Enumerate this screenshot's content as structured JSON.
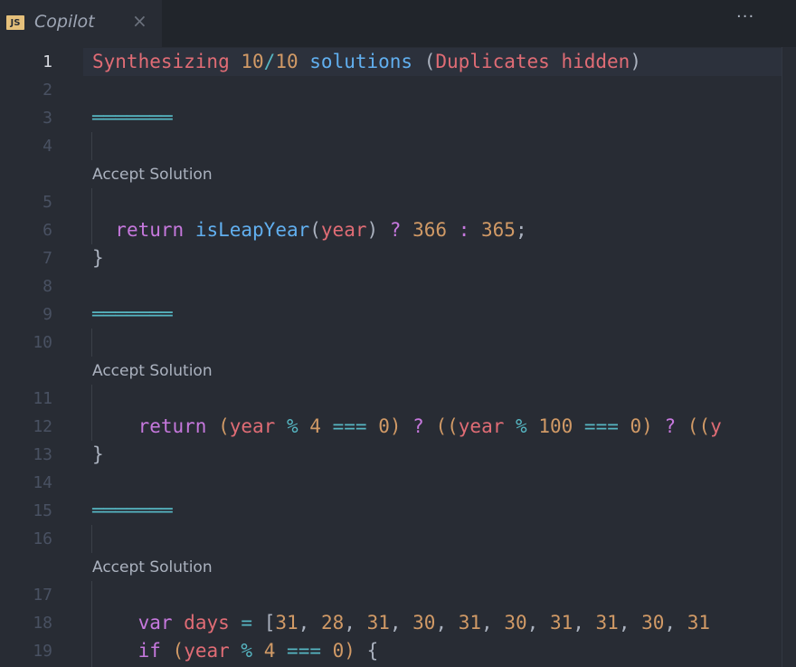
{
  "tab": {
    "badge": "JS",
    "title": "Copilot",
    "close_glyph": "×",
    "more_glyph": "···"
  },
  "gutter": {
    "line_numbers": [
      "1",
      "2",
      "3",
      "4",
      "5",
      "6",
      "7",
      "8",
      "9",
      "10",
      "11",
      "12",
      "13",
      "14",
      "15",
      "16",
      "17",
      "18",
      "19"
    ],
    "active_line": "1"
  },
  "header_line": {
    "word1": "Synthesizing",
    "count": "10",
    "slash": "/",
    "total": "10",
    "word2": "solutions",
    "paren_open": "(",
    "note": "Duplicates hidden",
    "paren_close": ")"
  },
  "separator": "═══════",
  "codelens_label": "Accept Solution",
  "solution1": {
    "kw_return": "return",
    "fn": "isLeapYear",
    "lp": "(",
    "arg": "year",
    "rp": ")",
    "q": "?",
    "n1": "366",
    "colon": ":",
    "n2": "365",
    "semi": ";",
    "close": "}"
  },
  "solution2": {
    "kw_return": "return",
    "lp": "(",
    "v1": "year",
    "mod": "%",
    "n4": "4",
    "eq1": "===",
    "z1": "0",
    "rp": ")",
    "q1": "?",
    "lp2": "((",
    "v2": "year",
    "mod2": "%",
    "n100": "100",
    "eq2": "===",
    "z2": "0",
    "rp2": ")",
    "q2": "?",
    "lp3": "((",
    "cut": "y",
    "close": "}"
  },
  "solution3": {
    "kw_var": "var",
    "var_name": "days",
    "assign": "=",
    "lb": "[",
    "days": [
      "31",
      "28",
      "31",
      "30",
      "31",
      "30",
      "31",
      "31",
      "30",
      "31"
    ],
    "kw_if": "if",
    "lp": "(",
    "v": "year",
    "mod": "%",
    "n4": "4",
    "eq": "===",
    "z": "0",
    "rp": ")",
    "brace": "{"
  },
  "colors": {
    "background": "#282c34",
    "tabbar": "#21252b",
    "red": "#e06c75",
    "orange": "#d19a66",
    "blue": "#61afef",
    "purple": "#c678dd",
    "cyan": "#56b6c2"
  }
}
